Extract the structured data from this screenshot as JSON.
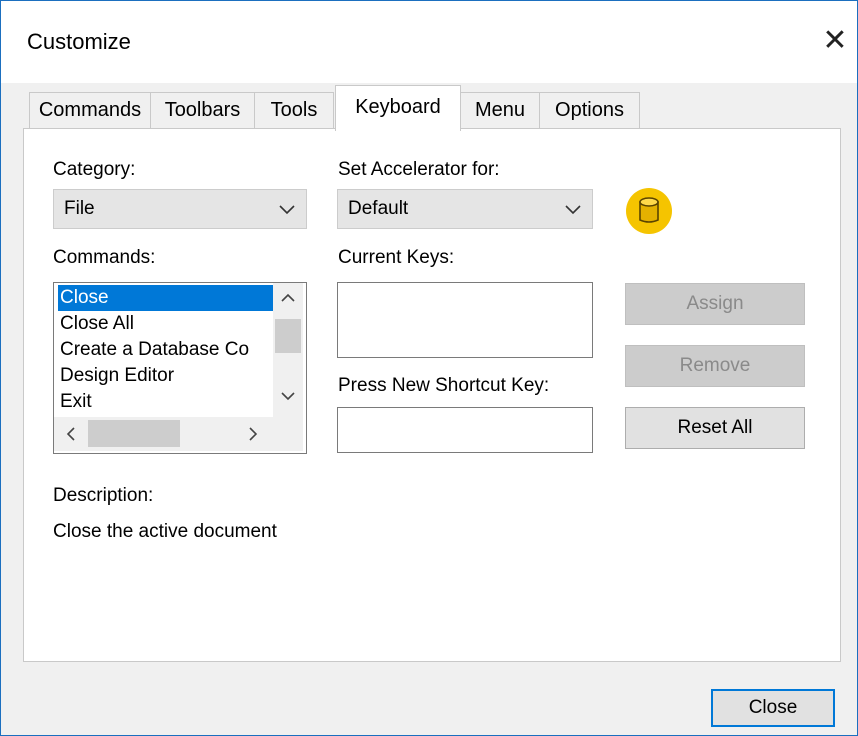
{
  "window": {
    "title": "Customize",
    "close_glyph": "✕"
  },
  "tabs": [
    {
      "label": "Commands",
      "active": false
    },
    {
      "label": "Toolbars",
      "active": false
    },
    {
      "label": "Tools",
      "active": false
    },
    {
      "label": "Keyboard",
      "active": true
    },
    {
      "label": "Menu",
      "active": false
    },
    {
      "label": "Options",
      "active": false
    }
  ],
  "category": {
    "label": "Category:",
    "value": "File"
  },
  "accelerator": {
    "label": "Set Accelerator for:",
    "value": "Default"
  },
  "commands": {
    "label": "Commands:",
    "items": [
      "Close",
      "Close All",
      "Create a Database Co",
      "Design Editor",
      "Exit"
    ],
    "selected_index": 0
  },
  "current_keys": {
    "label": "Current Keys:"
  },
  "shortcut": {
    "label": "Press New Shortcut Key:"
  },
  "buttons": {
    "assign": "Assign",
    "remove": "Remove",
    "reset_all": "Reset All",
    "close": "Close"
  },
  "description": {
    "label": "Description:",
    "text": "Close the active document"
  },
  "icon": {
    "name": "database-icon",
    "color": "#f5c400",
    "fill": "#e4b100"
  },
  "colors": {
    "selection": "#0078d7",
    "accent_border": "#1b6fbf"
  }
}
